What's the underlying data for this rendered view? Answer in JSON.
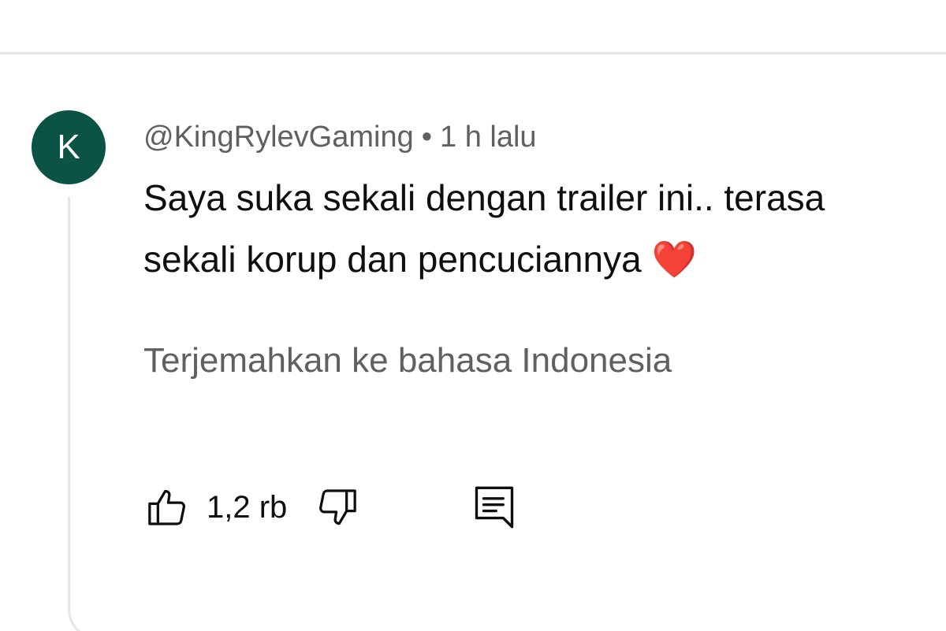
{
  "comment": {
    "avatar_letter": "K",
    "avatar_color": "#0b5344",
    "author": "@KingRylevGaming",
    "separator": "•",
    "time": "1 h lalu",
    "text_line1": "Saya suka sekali dengan trailer ini.. terasa",
    "text_line2": "sekali korup dan pencuciannya",
    "emoji": "❤️",
    "translate_label": "Terjemahkan ke bahasa Indonesia",
    "like_count": "1,2 rb",
    "icons": {
      "like": "thumbs-up-icon",
      "dislike": "thumbs-down-icon",
      "reply": "comment-reply-icon"
    }
  }
}
